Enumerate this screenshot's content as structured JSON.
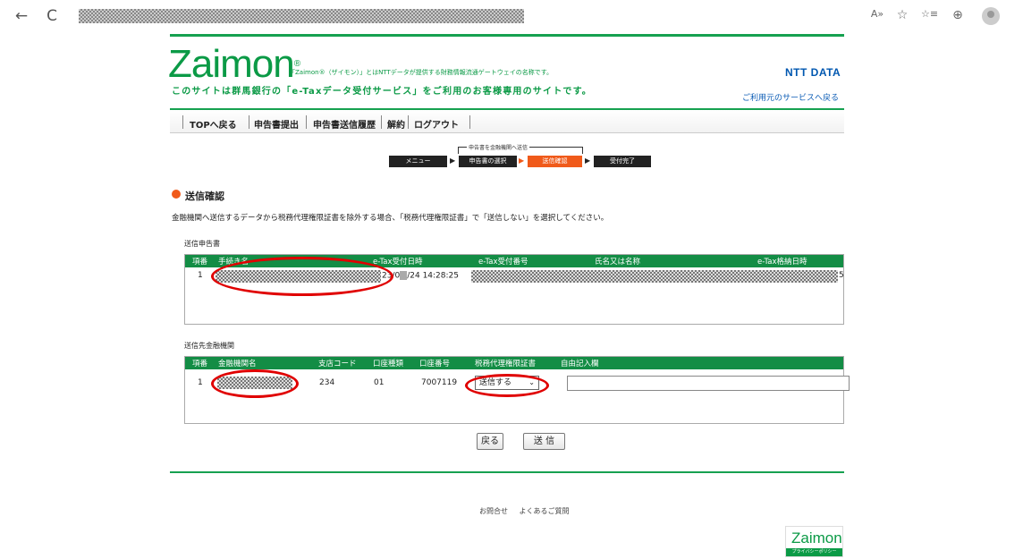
{
  "browser": {
    "back_icon": "←",
    "refresh_icon": "C",
    "read_aloud_icon": "A»",
    "favorite_icon": "☆",
    "favorites_icon": "☆≡",
    "collections_icon": "⊕"
  },
  "header": {
    "logo": "Zaimon",
    "logo_desc": "「Zaimon®（ザイモン）」とはNTTデータが提供する財務情報流通ゲートウェイの名称です。",
    "site_note": "このサイトは群馬銀行の「e-Taxデータ受付サービス」をご利用のお客様専用のサイトです。",
    "company": "NTT DATA",
    "return_link": "ご利用元のサービスへ戻る"
  },
  "menu": [
    "TOPへ戻る",
    "申告書提出",
    "申告書送信履歴",
    "解約",
    "ログアウト"
  ],
  "flow": {
    "title": "申告書を金融機関へ送信",
    "steps": [
      "メニュー",
      "申告書の選択",
      "送信確認",
      "受付完了"
    ]
  },
  "section": {
    "title": "送信確認",
    "instruction": "金融機関へ送信するデータから税務代理権限証書を除外する場合、「税務代理権限証書」で「送信しない」を選択してください。"
  },
  "returns_table": {
    "label": "送信申告書",
    "headers": [
      "項番",
      "手続き名",
      "e-Tax受付日時",
      "e-Tax受付番号",
      "氏名又は名称",
      "e-Tax格納日時"
    ],
    "rows": [
      {
        "no": "1",
        "datetime": "23/0",
        "datetime2": "/24 14:28:25",
        "stored_tail": "5"
      }
    ]
  },
  "banks_table": {
    "label": "送信先金融機関",
    "headers": [
      "項番",
      "金融機関名",
      "支店コード",
      "口座種類",
      "口座番号",
      "税務代理権限証書",
      "自由記入欄"
    ],
    "rows": [
      {
        "no": "1",
        "branch": "234",
        "type": "01",
        "account": "7007119",
        "proxy": "送信する"
      }
    ]
  },
  "buttons": {
    "back": "戻る",
    "send": "送 信"
  },
  "footer": {
    "links": [
      "お問合せ",
      "よくあるご質問"
    ],
    "logo": "Zaimon",
    "privacy": "プライバシーポリシー"
  }
}
